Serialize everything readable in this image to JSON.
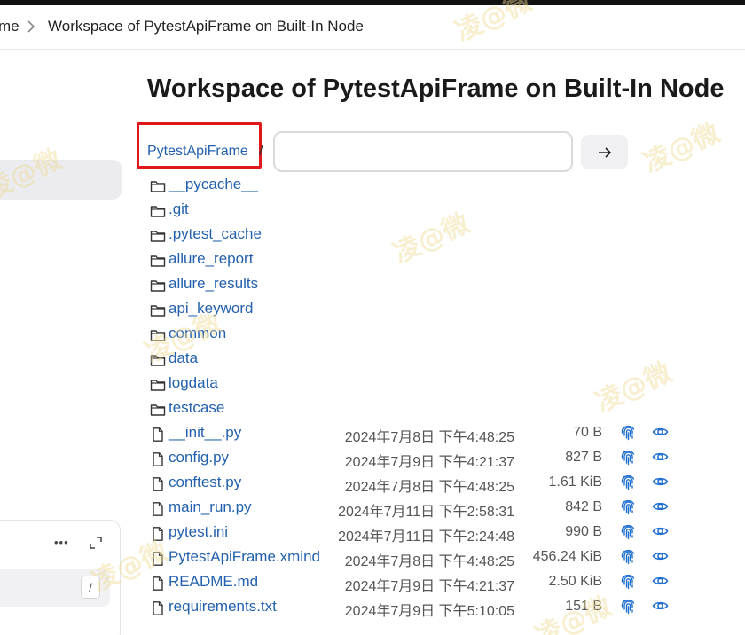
{
  "breadcrumb": {
    "previous": "me",
    "current": "Workspace of PytestApiFrame on Built-In Node"
  },
  "page": {
    "title": "Workspace of PytestApiFrame on Built-In Node"
  },
  "path_bar": {
    "root_link": "PytestApiFrame",
    "separator": "/",
    "input_value": "",
    "go_icon": "arrow-right-icon"
  },
  "sidebar_card": {
    "more_label": "•••",
    "slash_key": "/"
  },
  "watermark": "凌@微",
  "colors": {
    "link": "#2461ad",
    "highlight_box": "#e0171b",
    "watermark": "#eedc96"
  },
  "folders": [
    {
      "name": "__pycache__"
    },
    {
      "name": ".git"
    },
    {
      "name": ".pytest_cache"
    },
    {
      "name": "allure_report"
    },
    {
      "name": "allure_results"
    },
    {
      "name": "api_keyword"
    },
    {
      "name": "common"
    },
    {
      "name": "data"
    },
    {
      "name": "logdata"
    },
    {
      "name": "testcase"
    }
  ],
  "files": [
    {
      "name": "__init__.py",
      "date": "2024年7月8日 下午4:48:25",
      "size": "70 B"
    },
    {
      "name": "config.py",
      "date": "2024年7月9日 下午4:21:37",
      "size": "827 B"
    },
    {
      "name": "conftest.py",
      "date": "2024年7月8日 下午4:48:25",
      "size": "1.61 KiB"
    },
    {
      "name": "main_run.py",
      "date": "2024年7月11日 下午2:58:31",
      "size": "842 B"
    },
    {
      "name": "pytest.ini",
      "date": "2024年7月11日 下午2:24:48",
      "size": "990 B"
    },
    {
      "name": "PytestApiFrame.xmind",
      "date": "2024年7月8日 下午4:48:25",
      "size": "456.24 KiB"
    },
    {
      "name": "README.md",
      "date": "2024年7月9日 下午4:21:37",
      "size": "2.50 KiB"
    },
    {
      "name": "requirements.txt",
      "date": "2024年7月9日 下午5:10:05",
      "size": "151 B"
    }
  ]
}
